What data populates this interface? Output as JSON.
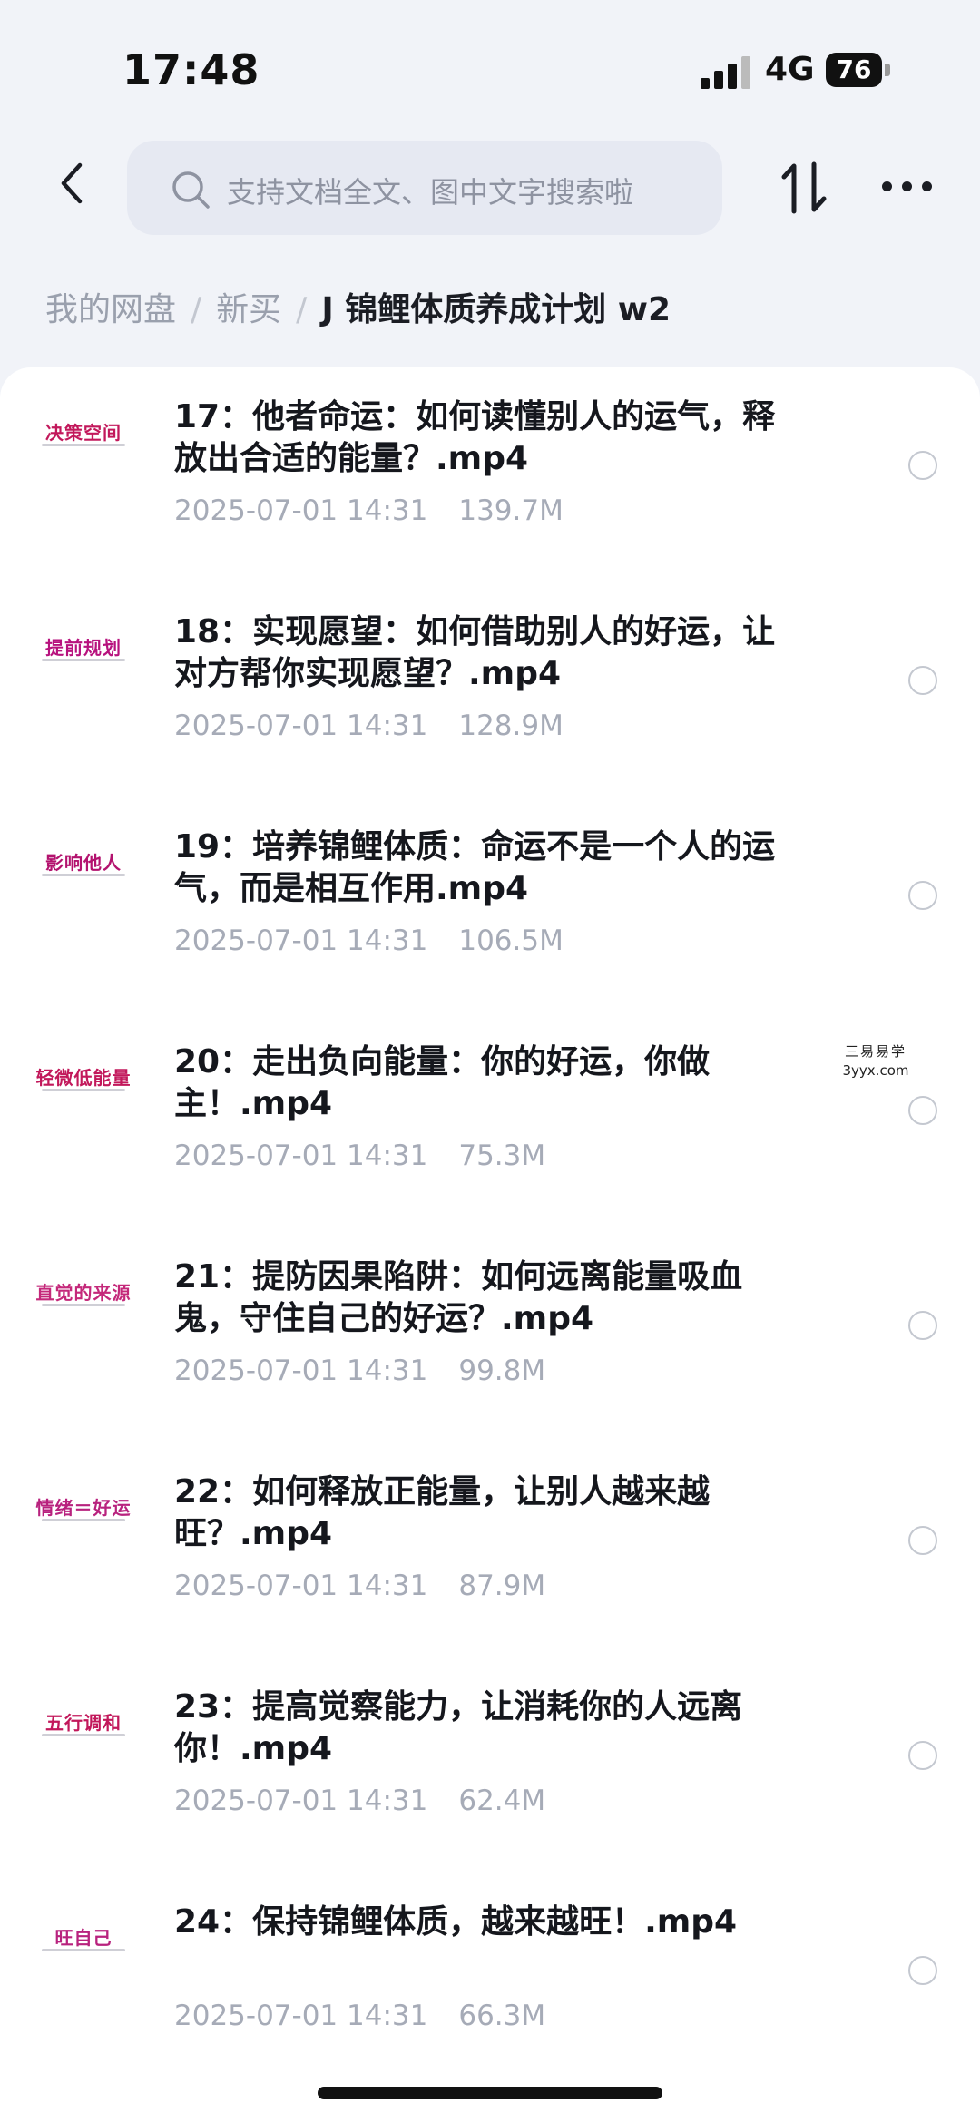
{
  "status_bar": {
    "time": "17:48",
    "network": "4G",
    "battery": "76"
  },
  "search": {
    "placeholder": "支持文档全文、图中文字搜索啦"
  },
  "icons": {
    "back": "chevron-left-icon",
    "search": "search-icon",
    "sort": "sort-arrows-icon",
    "more": "more-dots-icon"
  },
  "breadcrumb": {
    "items": [
      "我的网盘",
      "新买"
    ],
    "separator": "/",
    "current": "J 锦鲤体质养成计划 w2"
  },
  "files": [
    {
      "name": "17：他者命运：如何读懂别人的运气，释放出合适的能量？.mp4",
      "date": "2025-07-01 14:31",
      "size": "139.7M",
      "thumb": "决策空间",
      "thumb_color": "#c2185b"
    },
    {
      "name": "18：实现愿望：如何借助别人的好运，让对方帮你实现愿望？.mp4",
      "date": "2025-07-01 14:31",
      "size": "128.9M",
      "thumb": "提前规划",
      "thumb_color": "#b7127e"
    },
    {
      "name": "19：培养锦鲤体质：命运不是一个人的运气，而是相互作用.mp4",
      "date": "2025-07-01 14:31",
      "size": "106.5M",
      "thumb": "影响他人",
      "thumb_color": "#b3126e"
    },
    {
      "name": "20：走出负向能量：你的好运，你做主！.mp4",
      "date": "2025-07-01 14:31",
      "size": "75.3M",
      "thumb": "轻微低能量",
      "thumb_color": "#c2185b"
    },
    {
      "name": "21：提防因果陷阱：如何远离能量吸血鬼，守住自己的好运？.mp4",
      "date": "2025-07-01 14:31",
      "size": "99.8M",
      "thumb": "直觉的来源",
      "thumb_color": "#c4287a"
    },
    {
      "name": "22：如何释放正能量，让别人越来越旺？.mp4",
      "date": "2025-07-01 14:31",
      "size": "87.9M",
      "thumb": "情绪＝好运",
      "thumb_color": "#b8227e"
    },
    {
      "name": "23：提高觉察能力，让消耗你的人远离你！.mp4",
      "date": "2025-07-01 14:31",
      "size": "62.4M",
      "thumb": "五行调和",
      "thumb_color": "#c2185b"
    },
    {
      "name": "24：保持锦鲤体质，越来越旺！.mp4",
      "date": "2025-07-01 14:31",
      "size": "66.3M",
      "thumb": "旺自己",
      "thumb_color": "#b8227e"
    }
  ],
  "watermark": {
    "line1": "三易易学",
    "line2": "3yyx.com"
  }
}
